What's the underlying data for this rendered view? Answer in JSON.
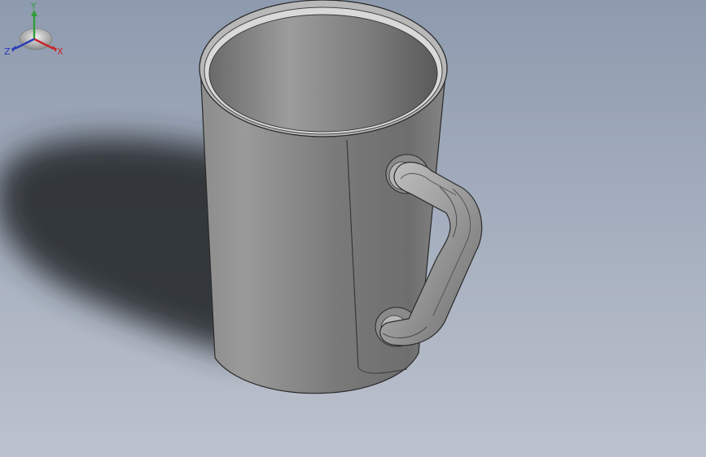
{
  "viewport": {
    "background_top": "#8e9aae",
    "background_bottom": "#bcc2cd"
  },
  "model": {
    "part": "mug",
    "body_color": "#8a8a8a",
    "edge_color": "#2a2a2a",
    "shadow_color": "#2c2f33"
  },
  "triad": {
    "x_label": "X",
    "y_label": "Y",
    "z_label": "Z",
    "x_color": "#c8262c",
    "y_color": "#2e9e3a",
    "z_color": "#2a3cb8"
  }
}
